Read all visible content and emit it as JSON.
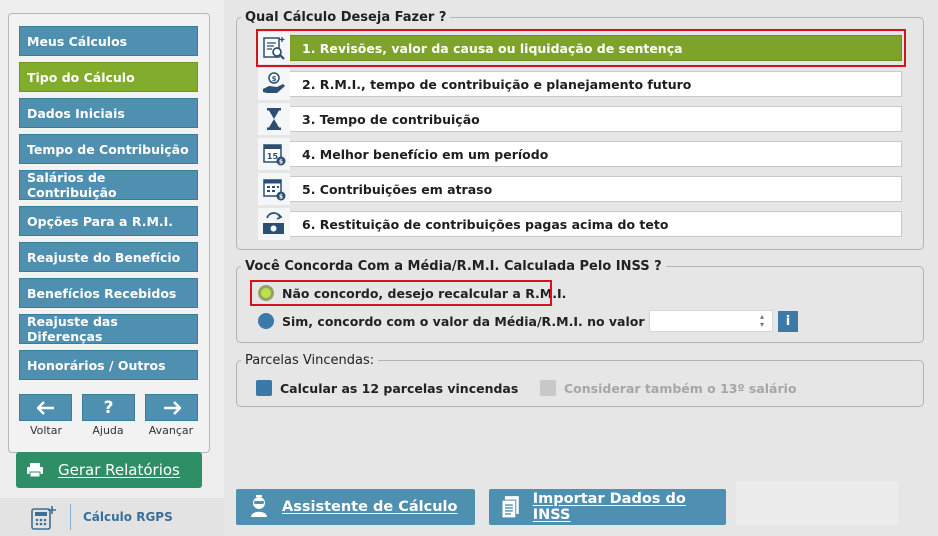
{
  "sidebar": {
    "items": [
      {
        "label": "Meus Cálculos",
        "active": false
      },
      {
        "label": "Tipo do Cálculo",
        "active": true
      },
      {
        "label": "Dados Iniciais",
        "active": false
      },
      {
        "label": "Tempo de Contribuição",
        "active": false
      },
      {
        "label": "Salários de Contribuição",
        "active": false
      },
      {
        "label": "Opções Para a R.M.I.",
        "active": false
      },
      {
        "label": "Reajuste do Benefício",
        "active": false
      },
      {
        "label": "Benefícios Recebidos",
        "active": false
      },
      {
        "label": "Reajuste das Diferenças",
        "active": false
      },
      {
        "label": "Honorários / Outros",
        "active": false
      }
    ],
    "nav": {
      "back_label": "Voltar",
      "help_label": "Ajuda",
      "help_glyph": "?",
      "forward_label": "Avançar"
    },
    "reports_button": "Gerar Relatórios",
    "brand_name": "Cálculo RGPS"
  },
  "main": {
    "calc_type": {
      "legend": "Qual Cálculo Deseja Fazer ?",
      "options": [
        {
          "label": "1. Revisões, valor da causa ou liquidação de sentença",
          "icon": "document-search-icon",
          "selected": true
        },
        {
          "label": "2. R.M.I., tempo de contribuição e planejamento futuro",
          "icon": "hand-coin-icon",
          "selected": false
        },
        {
          "label": "3. Tempo de contribuição",
          "icon": "hourglass-icon",
          "selected": false
        },
        {
          "label": "4. Melhor benefício em um período",
          "icon": "calendar-15-icon",
          "selected": false
        },
        {
          "label": "5. Contribuições em atraso",
          "icon": "calendar-money-icon",
          "selected": false
        },
        {
          "label": "6. Restituição de contribuições pagas acima do teto",
          "icon": "money-refund-icon",
          "selected": false
        }
      ]
    },
    "rmi": {
      "legend": "Você Concorda Com a Média/R.M.I. Calculada Pelo INSS ?",
      "option_disagree": "Não concordo, desejo recalcular a R.M.I.",
      "option_agree": "Sim, concordo com o valor da Média/R.M.I. no valor de",
      "value": "",
      "info_glyph": "i"
    },
    "parcelas": {
      "legend": "Parcelas Vincendas:",
      "check_12": "Calcular as 12 parcelas vincendas",
      "check_13": "Considerar também o 13º salário"
    },
    "bottom": {
      "assistant_button": "Assistente de Cálculo",
      "import_button": "Importar Dados do INSS"
    }
  },
  "colors": {
    "nav_blue": "#4f8fb0",
    "active_green": "#82ac2c",
    "reports_green": "#2e8f67",
    "highlight_red": "#d8121d"
  }
}
